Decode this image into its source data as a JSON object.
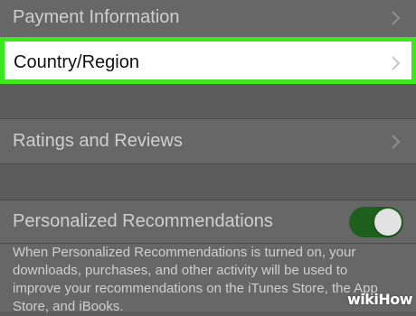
{
  "colors": {
    "background": "#5c5c5c",
    "row_background": "#676767",
    "highlight_border": "#3fe61d",
    "toggle_on": "#1e5f1e"
  },
  "rows": {
    "payment": {
      "label": "Payment Information",
      "icon": "chevron-right-icon"
    },
    "country": {
      "label": "Country/Region",
      "icon": "chevron-right-icon"
    },
    "ratings": {
      "label": "Ratings and Reviews",
      "icon": "chevron-right-icon"
    },
    "personalized": {
      "label": "Personalized Recommendations",
      "toggle_on": true,
      "description": "When Personalized Recommendations is turned on, your downloads, purchases, and other activity will be used to improve your recommendations on the iTunes Store, the App Store, and iBooks."
    }
  },
  "watermark": {
    "wiki": "wiki",
    "how": "How"
  }
}
